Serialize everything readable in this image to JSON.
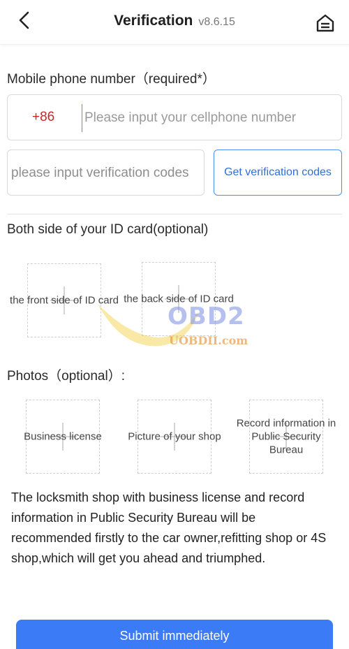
{
  "header": {
    "title": "Verification",
    "version": "v8.6.15",
    "back_icon": "chevron-left-icon",
    "home_icon": "home-icon"
  },
  "phone_section": {
    "label": "Mobile phone number（required*）",
    "country_code": "+86",
    "phone_placeholder": "Please input your cellphone number",
    "code_placeholder": "please input verification codes",
    "get_code_label": "Get verification codes"
  },
  "id_section": {
    "label": "Both side of your ID card(optional)",
    "front_label": "the front side of ID card",
    "back_label": "the back side of ID card"
  },
  "photos_section": {
    "label": "Photos（optional）:",
    "business_license": "Business license",
    "shop_picture": "Picture of your shop",
    "record_info": "Record information in Public Security Bureau"
  },
  "info_text": "The locksmith shop with business license and record information in Public Security Bureau will be recommended firstly to the car owner,refitting shop or 4S shop,which will get you ahead and triumphed.",
  "submit_label": "Submit immediately",
  "watermark": {
    "brand": "OBD2",
    "site": "UOBDII.com"
  },
  "colors": {
    "accent": "#3b7bf5",
    "country_code": "#c8272d",
    "divider_green": "#4caf50"
  }
}
